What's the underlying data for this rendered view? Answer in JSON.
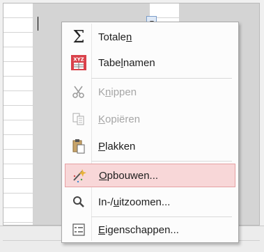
{
  "menu": {
    "items": [
      {
        "pre": "Totale",
        "accel": "n",
        "post": "",
        "icon": "sigma-icon",
        "enabled": true
      },
      {
        "pre": "Tabe",
        "accel": "l",
        "post": "namen",
        "icon": "table-names-icon",
        "enabled": true
      },
      {
        "pre": "K",
        "accel": "n",
        "post": "ippen",
        "icon": "scissors-icon",
        "enabled": false
      },
      {
        "pre": "",
        "accel": "K",
        "post": "opiëren",
        "icon": "copy-icon",
        "enabled": false
      },
      {
        "pre": "",
        "accel": "P",
        "post": "lakken",
        "icon": "paste-icon",
        "enabled": true
      },
      {
        "pre": "",
        "accel": "O",
        "post": "pbouwen...",
        "icon": "build-wand-icon",
        "enabled": true,
        "highlighted": true
      },
      {
        "pre": "In-/",
        "accel": "u",
        "post": "itzoomen...",
        "icon": "zoom-magnifier-icon",
        "enabled": true
      },
      {
        "pre": "",
        "accel": "E",
        "post": "igenschappen...",
        "icon": "properties-icon",
        "enabled": true
      }
    ],
    "icon_glyphs": {
      "sigma": "Σ",
      "table_names_text": "XYZ"
    }
  },
  "colors": {
    "highlight": "#f8d7d8",
    "highlight_border": "#e6a0a2",
    "disabled_text": "#a6a6a6"
  }
}
